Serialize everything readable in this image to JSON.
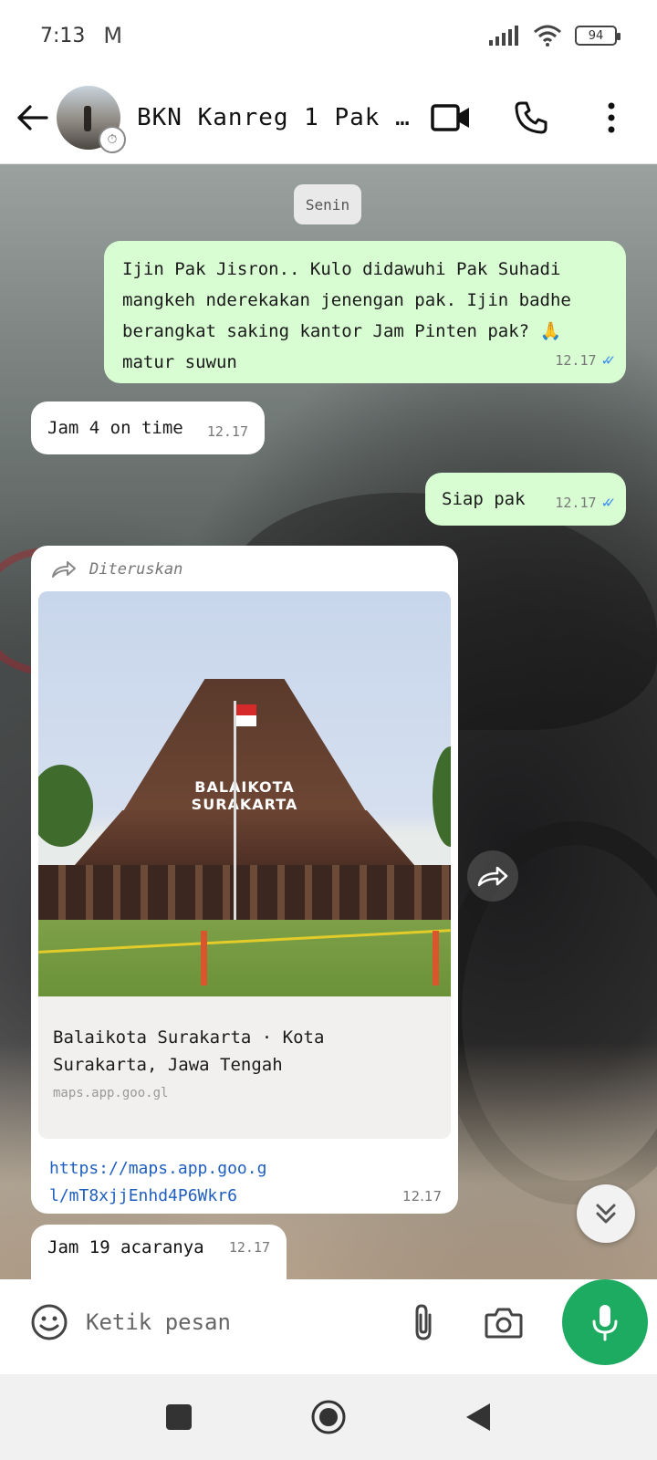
{
  "status_bar": {
    "time": "7:13",
    "mail_icon": "M",
    "battery": "94"
  },
  "header": {
    "title": "BKN Kanreg 1 Pak Ji...",
    "icons": [
      "back-arrow-icon",
      "video-call-icon",
      "phone-icon",
      "more-vert-icon"
    ]
  },
  "chat": {
    "date_chip": "Senin",
    "messages": [
      {
        "direction": "out",
        "text": "Ijin Pak Jisron.. Kulo didawuhi Pak Suhadi mangkeh nderekakan jenengan pak. Ijin badhe berangkat saking kantor Jam Pinten pak?",
        "emoji": "🙏",
        "text_after_emoji": "matur suwun",
        "time": "12.17",
        "status": "read"
      },
      {
        "direction": "in",
        "text": "Jam 4 on time",
        "time": "12.17"
      },
      {
        "direction": "out",
        "text": "Siap pak",
        "time": "12.17",
        "status": "read"
      },
      {
        "direction": "in",
        "forwarded_label": "Diteruskan",
        "image_sign": "BALAIKOTA SURAKARTA",
        "place_title": "Balaikota Surakarta · Kota Surakarta, Jawa Tengah",
        "place_domain": "maps.app.goo.gl",
        "link": "https://maps.app.goo.gl/mT8xjjEnhd4P6Wkr6",
        "time": "12.17"
      },
      {
        "direction": "in",
        "text": "Jam 19 acaranya",
        "time": "12.17"
      }
    ]
  },
  "composer": {
    "placeholder": "Ketik pesan"
  },
  "colors": {
    "outgoing_bubble": "#d9fdd3",
    "incoming_bubble": "#ffffff",
    "accent_green": "#1daa61",
    "read_ticks": "#3b8ef0",
    "link": "#1f5fbf"
  }
}
